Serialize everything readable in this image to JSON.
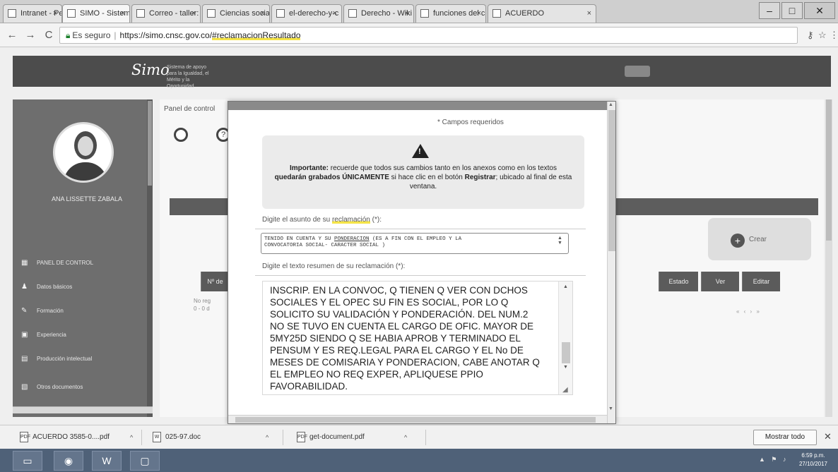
{
  "browser": {
    "tabs": [
      {
        "label": "Intranet - Perso"
      },
      {
        "label": "SIMO - Sistema"
      },
      {
        "label": "Correo - taller:"
      },
      {
        "label": "Ciencias sociale"
      },
      {
        "label": "el-derecho-y-c"
      },
      {
        "label": "Derecho - Wiki"
      },
      {
        "label": "funciones del c"
      },
      {
        "label": "ACUERDO"
      }
    ],
    "window_controls": {
      "minimize": "–",
      "maximize": "□",
      "close": "✕"
    },
    "nav": {
      "back": "←",
      "forward": "→",
      "reload": "C"
    },
    "address": {
      "secure_label": "Es seguro",
      "url_base": "https://simo.cnsc.gov.co/",
      "url_hash": "#reclamacionResultado"
    },
    "key_icon": "key-icon",
    "star_icon": "star-icon"
  },
  "site": {
    "logo": "Simo",
    "logo_subtitle": "Sistema de apoyo para la Igualdad, el Mérito y la Oportunidad"
  },
  "sidebar": {
    "user_name": "ANA LISSETTE ZABALA",
    "items": [
      {
        "label": "PANEL DE CONTROL",
        "icon": "dashboard-icon"
      },
      {
        "label": "Datos básicos",
        "icon": "user-icon"
      },
      {
        "label": "Formación",
        "icon": "education-icon"
      },
      {
        "label": "Experiencia",
        "icon": "briefcase-icon"
      },
      {
        "label": "Producción intelectual",
        "icon": "book-icon"
      },
      {
        "label": "Otros documentos",
        "icon": "folder-icon"
      }
    ]
  },
  "main": {
    "panel_title": "Panel de control",
    "crear_label": "Crear",
    "columns": [
      {
        "label": "Nº de"
      },
      {
        "label": "Estado"
      },
      {
        "label": "Ver"
      },
      {
        "label": "Editar"
      }
    ],
    "grid_info": "No reg\n0 - 0 d",
    "pager": "« ‹ › »"
  },
  "modal": {
    "required_note": "* Campos requeridos",
    "notice": {
      "prefix": "Importante:",
      "text_1": " recuerde que todos sus cambios tanto en los anexos como en los textos ",
      "bold_1": "quedarán grabados ÚNICAMENTE",
      "text_2": " si hace clic en el botón ",
      "bold_2": "Registrar",
      "text_3": "; ubicado al final de esta ventana."
    },
    "subject_label_pre": "Digite el asunto de su ",
    "subject_label_hl": "reclamación",
    "subject_label_post": " (*):",
    "subject_value_1": "TENIDO EN CUENTA Y SU ",
    "subject_value_u": "PONDERACION",
    "subject_value_2": " (ES A FIN CON EL EMPLEO Y LA\nCONVOCATORIA SOCIAL- CARACTER SOCIAL )",
    "body_label": "Digite el texto resumen de su reclamación (*):",
    "body_value": "INSCRIP. EN LA CONVOC, Q TIENEN Q VER CON DCHOS\nSOCIALES Y EL OPEC SU FIN ES SOCIAL, POR LO Q\nSOLICITO SU VALIDACIÓN Y PONDERACIÓN. DEL NUM.2\nNO SE TUVO EN CUENTA EL CARGO DE OFIC. MAYOR DE\n5MY25D SIENDO Q SE HABIA APROB Y TERMINADO EL\nPENSUM Y ES REQ.LEGAL PARA EL CARGO Y EL No DE\nMESES DE COMISARIA Y PONDERACION, CABE ANOTAR Q\nEL EMPLEO NO REQ EXPER, APLIQUESE PPIO\nFAVORABILIDAD."
  },
  "downloads": {
    "items": [
      {
        "name": "ACUERDO 3585-0....pdf",
        "icon": "pdf-icon"
      },
      {
        "name": "025-97.doc",
        "icon": "doc-icon"
      },
      {
        "name": "get-document.pdf",
        "icon": "pdf-icon"
      }
    ],
    "show_all": "Mostrar todo",
    "close": "✕"
  },
  "taskbar": {
    "items": [
      {
        "icon": "folder-icon",
        "glyph": "▭"
      },
      {
        "icon": "chrome-icon",
        "glyph": "◉"
      },
      {
        "icon": "word-icon",
        "glyph": "W"
      },
      {
        "icon": "app-icon",
        "glyph": "▢"
      }
    ],
    "tray": "▲ ⚑ ♪",
    "time": "6:59 p.m.",
    "date": "27/10/2017"
  }
}
